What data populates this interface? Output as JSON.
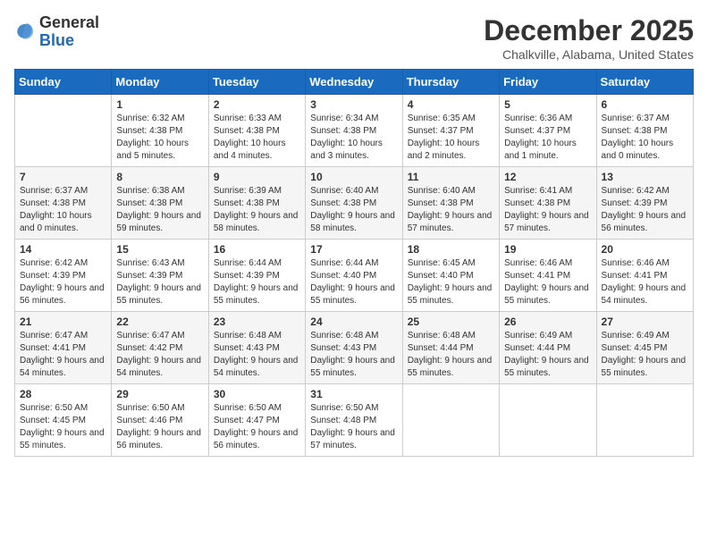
{
  "header": {
    "logo": {
      "general": "General",
      "blue": "Blue"
    },
    "title": "December 2025",
    "location": "Chalkville, Alabama, United States"
  },
  "weekdays": [
    "Sunday",
    "Monday",
    "Tuesday",
    "Wednesday",
    "Thursday",
    "Friday",
    "Saturday"
  ],
  "weeks": [
    [
      {
        "day": "",
        "sunrise": "",
        "sunset": "",
        "daylight": ""
      },
      {
        "day": "1",
        "sunrise": "Sunrise: 6:32 AM",
        "sunset": "Sunset: 4:38 PM",
        "daylight": "Daylight: 10 hours and 5 minutes."
      },
      {
        "day": "2",
        "sunrise": "Sunrise: 6:33 AM",
        "sunset": "Sunset: 4:38 PM",
        "daylight": "Daylight: 10 hours and 4 minutes."
      },
      {
        "day": "3",
        "sunrise": "Sunrise: 6:34 AM",
        "sunset": "Sunset: 4:38 PM",
        "daylight": "Daylight: 10 hours and 3 minutes."
      },
      {
        "day": "4",
        "sunrise": "Sunrise: 6:35 AM",
        "sunset": "Sunset: 4:37 PM",
        "daylight": "Daylight: 10 hours and 2 minutes."
      },
      {
        "day": "5",
        "sunrise": "Sunrise: 6:36 AM",
        "sunset": "Sunset: 4:37 PM",
        "daylight": "Daylight: 10 hours and 1 minute."
      },
      {
        "day": "6",
        "sunrise": "Sunrise: 6:37 AM",
        "sunset": "Sunset: 4:38 PM",
        "daylight": "Daylight: 10 hours and 0 minutes."
      }
    ],
    [
      {
        "day": "7",
        "sunrise": "Sunrise: 6:37 AM",
        "sunset": "Sunset: 4:38 PM",
        "daylight": "Daylight: 10 hours and 0 minutes."
      },
      {
        "day": "8",
        "sunrise": "Sunrise: 6:38 AM",
        "sunset": "Sunset: 4:38 PM",
        "daylight": "Daylight: 9 hours and 59 minutes."
      },
      {
        "day": "9",
        "sunrise": "Sunrise: 6:39 AM",
        "sunset": "Sunset: 4:38 PM",
        "daylight": "Daylight: 9 hours and 58 minutes."
      },
      {
        "day": "10",
        "sunrise": "Sunrise: 6:40 AM",
        "sunset": "Sunset: 4:38 PM",
        "daylight": "Daylight: 9 hours and 58 minutes."
      },
      {
        "day": "11",
        "sunrise": "Sunrise: 6:40 AM",
        "sunset": "Sunset: 4:38 PM",
        "daylight": "Daylight: 9 hours and 57 minutes."
      },
      {
        "day": "12",
        "sunrise": "Sunrise: 6:41 AM",
        "sunset": "Sunset: 4:38 PM",
        "daylight": "Daylight: 9 hours and 57 minutes."
      },
      {
        "day": "13",
        "sunrise": "Sunrise: 6:42 AM",
        "sunset": "Sunset: 4:39 PM",
        "daylight": "Daylight: 9 hours and 56 minutes."
      }
    ],
    [
      {
        "day": "14",
        "sunrise": "Sunrise: 6:42 AM",
        "sunset": "Sunset: 4:39 PM",
        "daylight": "Daylight: 9 hours and 56 minutes."
      },
      {
        "day": "15",
        "sunrise": "Sunrise: 6:43 AM",
        "sunset": "Sunset: 4:39 PM",
        "daylight": "Daylight: 9 hours and 55 minutes."
      },
      {
        "day": "16",
        "sunrise": "Sunrise: 6:44 AM",
        "sunset": "Sunset: 4:39 PM",
        "daylight": "Daylight: 9 hours and 55 minutes."
      },
      {
        "day": "17",
        "sunrise": "Sunrise: 6:44 AM",
        "sunset": "Sunset: 4:40 PM",
        "daylight": "Daylight: 9 hours and 55 minutes."
      },
      {
        "day": "18",
        "sunrise": "Sunrise: 6:45 AM",
        "sunset": "Sunset: 4:40 PM",
        "daylight": "Daylight: 9 hours and 55 minutes."
      },
      {
        "day": "19",
        "sunrise": "Sunrise: 6:46 AM",
        "sunset": "Sunset: 4:41 PM",
        "daylight": "Daylight: 9 hours and 55 minutes."
      },
      {
        "day": "20",
        "sunrise": "Sunrise: 6:46 AM",
        "sunset": "Sunset: 4:41 PM",
        "daylight": "Daylight: 9 hours and 54 minutes."
      }
    ],
    [
      {
        "day": "21",
        "sunrise": "Sunrise: 6:47 AM",
        "sunset": "Sunset: 4:41 PM",
        "daylight": "Daylight: 9 hours and 54 minutes."
      },
      {
        "day": "22",
        "sunrise": "Sunrise: 6:47 AM",
        "sunset": "Sunset: 4:42 PM",
        "daylight": "Daylight: 9 hours and 54 minutes."
      },
      {
        "day": "23",
        "sunrise": "Sunrise: 6:48 AM",
        "sunset": "Sunset: 4:43 PM",
        "daylight": "Daylight: 9 hours and 54 minutes."
      },
      {
        "day": "24",
        "sunrise": "Sunrise: 6:48 AM",
        "sunset": "Sunset: 4:43 PM",
        "daylight": "Daylight: 9 hours and 55 minutes."
      },
      {
        "day": "25",
        "sunrise": "Sunrise: 6:48 AM",
        "sunset": "Sunset: 4:44 PM",
        "daylight": "Daylight: 9 hours and 55 minutes."
      },
      {
        "day": "26",
        "sunrise": "Sunrise: 6:49 AM",
        "sunset": "Sunset: 4:44 PM",
        "daylight": "Daylight: 9 hours and 55 minutes."
      },
      {
        "day": "27",
        "sunrise": "Sunrise: 6:49 AM",
        "sunset": "Sunset: 4:45 PM",
        "daylight": "Daylight: 9 hours and 55 minutes."
      }
    ],
    [
      {
        "day": "28",
        "sunrise": "Sunrise: 6:50 AM",
        "sunset": "Sunset: 4:45 PM",
        "daylight": "Daylight: 9 hours and 55 minutes."
      },
      {
        "day": "29",
        "sunrise": "Sunrise: 6:50 AM",
        "sunset": "Sunset: 4:46 PM",
        "daylight": "Daylight: 9 hours and 56 minutes."
      },
      {
        "day": "30",
        "sunrise": "Sunrise: 6:50 AM",
        "sunset": "Sunset: 4:47 PM",
        "daylight": "Daylight: 9 hours and 56 minutes."
      },
      {
        "day": "31",
        "sunrise": "Sunrise: 6:50 AM",
        "sunset": "Sunset: 4:48 PM",
        "daylight": "Daylight: 9 hours and 57 minutes."
      },
      {
        "day": "",
        "sunrise": "",
        "sunset": "",
        "daylight": ""
      },
      {
        "day": "",
        "sunrise": "",
        "sunset": "",
        "daylight": ""
      },
      {
        "day": "",
        "sunrise": "",
        "sunset": "",
        "daylight": ""
      }
    ]
  ]
}
